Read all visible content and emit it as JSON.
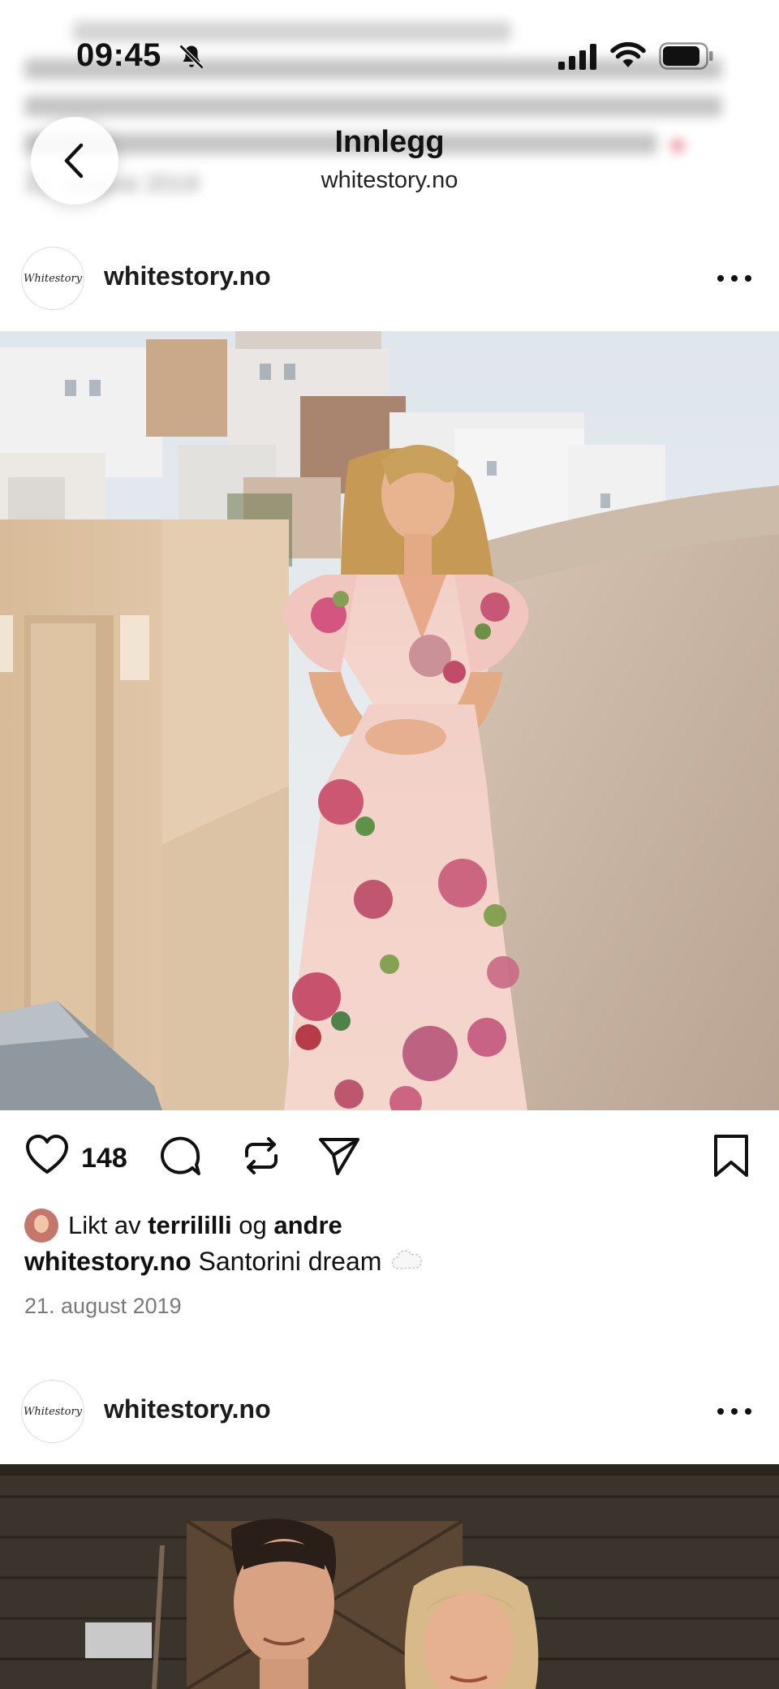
{
  "background_caption": {
    "lines": [
      "",
      "",
      "",
      "21. august 2019"
    ]
  },
  "status_bar": {
    "time": "09:45",
    "icons": [
      "bell-off-icon",
      "signal-icon",
      "wifi-icon",
      "battery-icon"
    ]
  },
  "header": {
    "title": "Innlegg",
    "subtitle": "whitestory.no",
    "back_icon": "chevron-left-icon"
  },
  "posts": [
    {
      "username": "whitestory.no",
      "avatar_text": "Whitestory",
      "image": "woman-floral-dress-santorini",
      "like_count": "148",
      "liked_by_prefix": "Likt av",
      "liked_by_user1": "terrililli",
      "liked_by_joiner": "og",
      "liked_by_user2": "andre",
      "caption_user": "whitestory.no",
      "caption_text": "Santorini dream",
      "caption_emoji": "cloud-icon",
      "date": "21. august 2019"
    },
    {
      "username": "whitestory.no",
      "avatar_text": "Whitestory",
      "image": "couple-wooden-cabin"
    }
  ],
  "actions": [
    "heart-icon",
    "comment-icon",
    "repost-icon",
    "share-icon",
    "bookmark-icon"
  ],
  "colors": {
    "background": "#ffffff",
    "text": "#111111",
    "secondary_text": "#7a7a7a",
    "sky": "#dde6ee",
    "wall": "#d9bfa3",
    "dress": "#f3cfc9",
    "dome": "#2f63b8"
  }
}
